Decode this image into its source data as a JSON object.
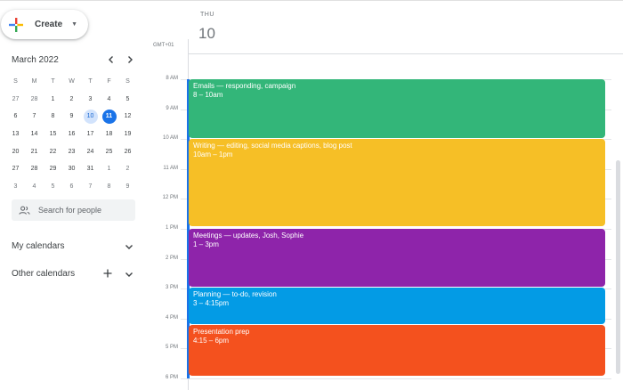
{
  "create": {
    "label": "Create"
  },
  "mini_calendar": {
    "month_label": "March 2022",
    "weekday_headers": [
      "S",
      "M",
      "T",
      "W",
      "T",
      "F",
      "S"
    ],
    "weeks": [
      [
        "27",
        "28",
        "1",
        "2",
        "3",
        "4",
        "5"
      ],
      [
        "6",
        "7",
        "8",
        "9",
        "10",
        "11",
        "12"
      ],
      [
        "13",
        "14",
        "15",
        "16",
        "17",
        "18",
        "19"
      ],
      [
        "20",
        "21",
        "22",
        "23",
        "24",
        "25",
        "26"
      ],
      [
        "27",
        "28",
        "29",
        "30",
        "31",
        "1",
        "2"
      ],
      [
        "3",
        "4",
        "5",
        "6",
        "7",
        "8",
        "9"
      ]
    ],
    "selected_day": "10",
    "today_day": "11"
  },
  "people_search": {
    "placeholder": "Search for people"
  },
  "my_calendars": {
    "label": "My calendars"
  },
  "other_calendars": {
    "label": "Other calendars"
  },
  "day_view": {
    "weekday": "THU",
    "date": "10",
    "timezone": "GMT+01",
    "hour_labels": [
      "8 AM",
      "9 AM",
      "10 AM",
      "11 AM",
      "12 PM",
      "1 PM",
      "2 PM",
      "3 PM",
      "4 PM",
      "5 PM",
      "6 PM"
    ],
    "events": [
      {
        "title": "Emails — responding, campaign",
        "time": "8 – 10am",
        "color": "#33b679"
      },
      {
        "title": "Writing — editing, social media captions, blog post",
        "time": "10am – 1pm",
        "color": "#f6bf26"
      },
      {
        "title": "Meetings — updates, Josh, Sophie",
        "time": "1 – 3pm",
        "color": "#8e24aa"
      },
      {
        "title": "Planning — to-do, revision",
        "time": "3 – 4:15pm",
        "color": "#039be5"
      },
      {
        "title": "Presentation prep",
        "time": "4:15 – 6pm",
        "color": "#f4511e"
      }
    ]
  }
}
